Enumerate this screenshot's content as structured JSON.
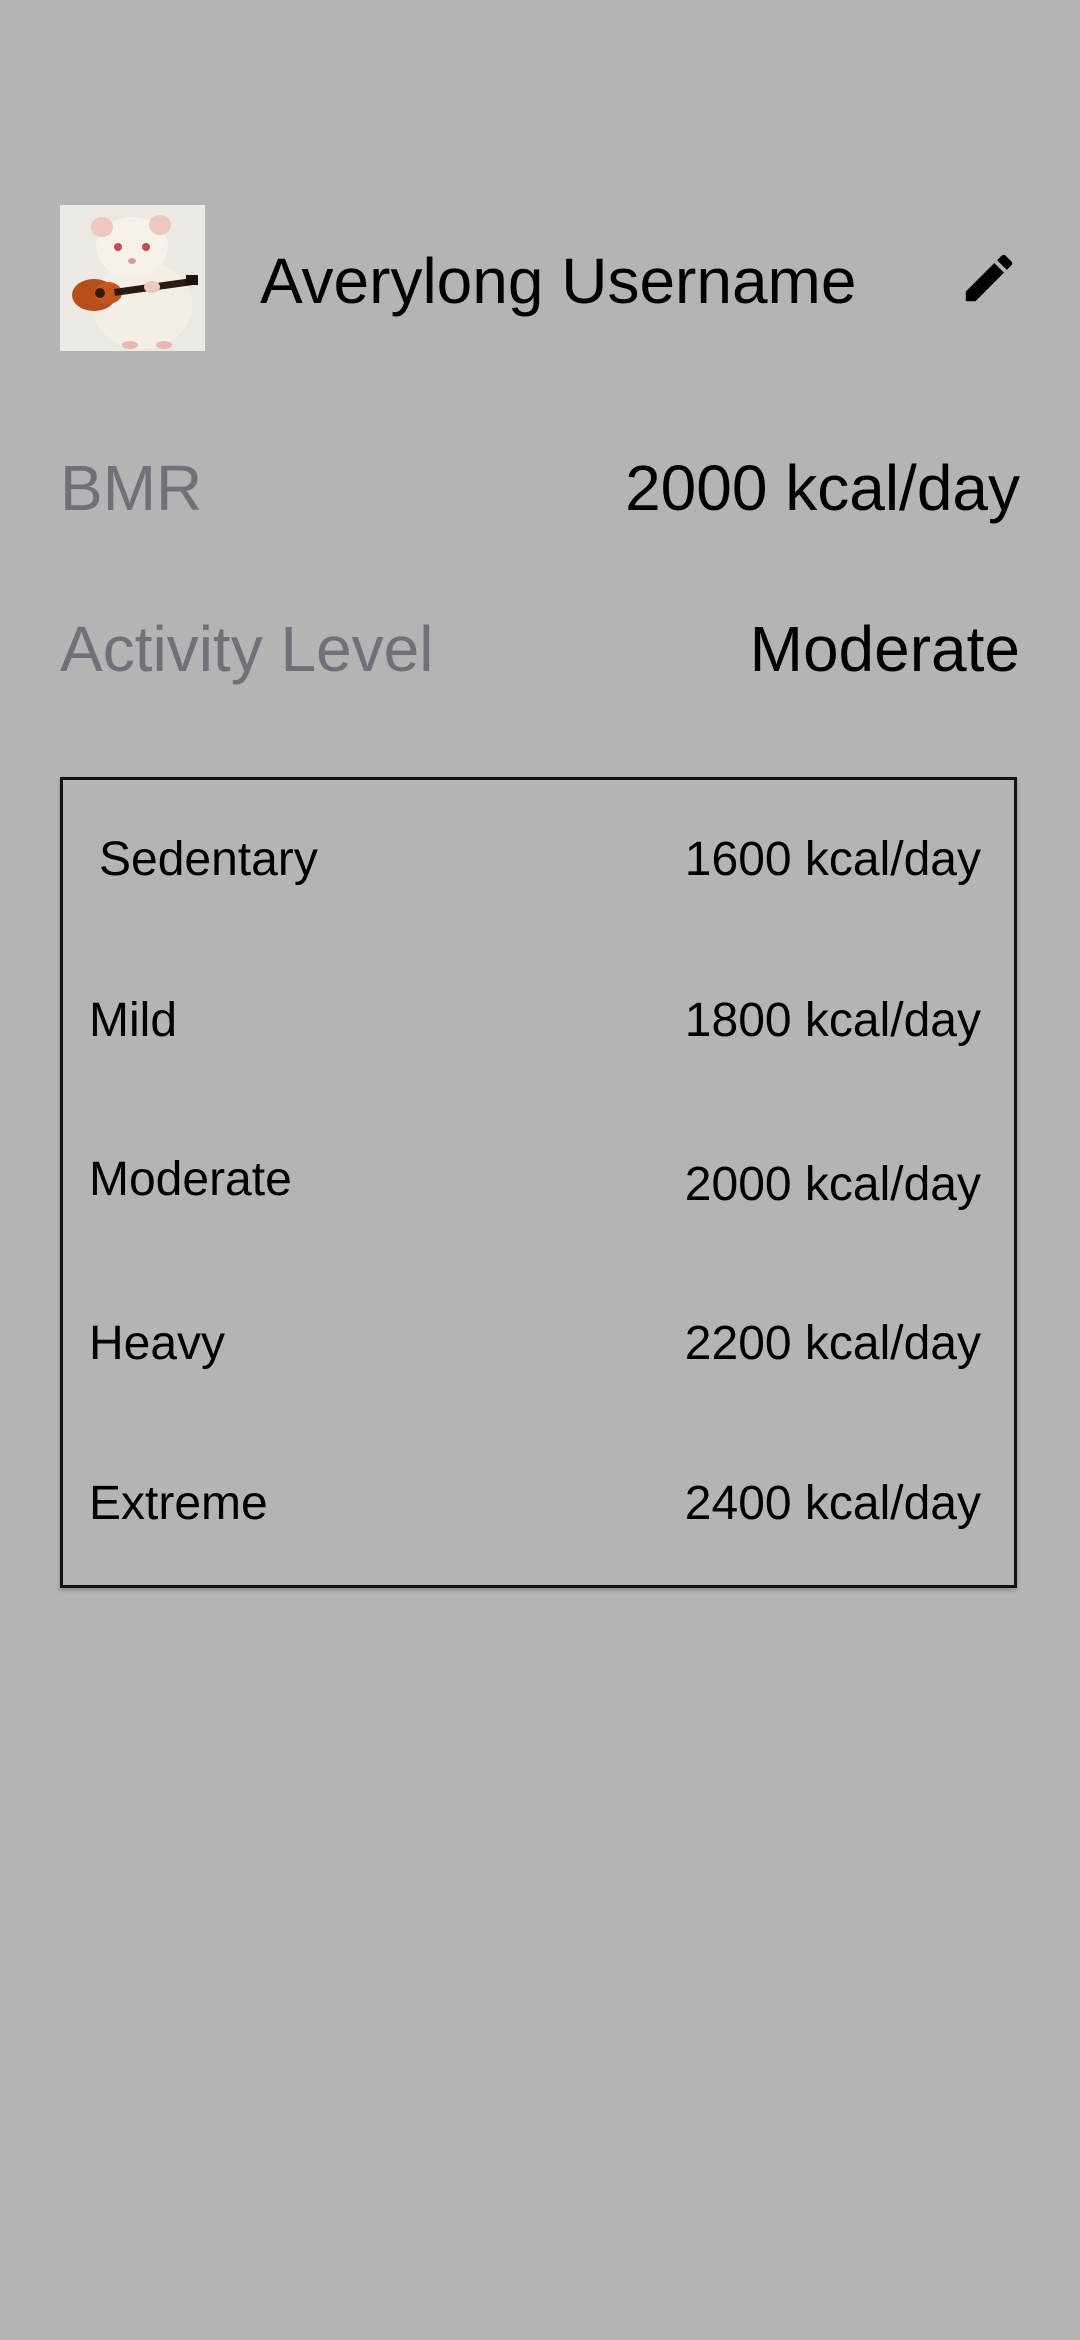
{
  "profile": {
    "avatar_alt": "rat holding a guitar",
    "username": "Averylong Username",
    "edit_icon": "pencil-icon"
  },
  "stats": {
    "bmr_label": "BMR",
    "bmr_value": "2000 kcal/day",
    "activity_label": "Activity Level",
    "activity_value": "Moderate"
  },
  "activity_levels": [
    {
      "name": "Sedentary",
      "kcal": "1600 kcal/day"
    },
    {
      "name": "Mild",
      "kcal": "1800 kcal/day"
    },
    {
      "name": "Moderate",
      "kcal": "2000 kcal/day"
    },
    {
      "name": "Heavy",
      "kcal": "2200 kcal/day"
    },
    {
      "name": "Extreme",
      "kcal": "2400 kcal/day"
    }
  ],
  "colors": {
    "background": "#b4b4b4",
    "label_gray": "#707078",
    "text": "#000000",
    "box_border": "#111111"
  }
}
